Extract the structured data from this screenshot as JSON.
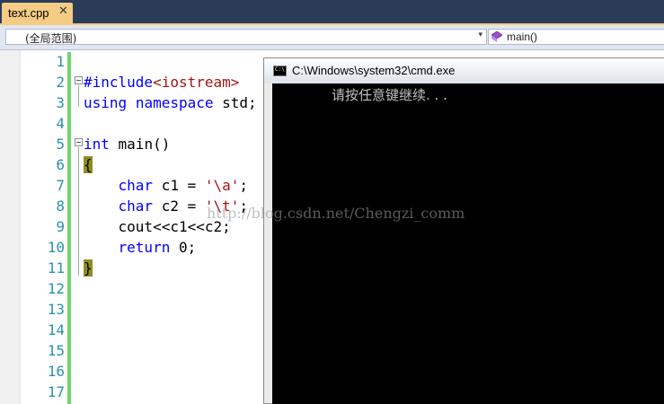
{
  "tab": {
    "filename": "text.cpp",
    "close_glyph": "✕"
  },
  "navbar": {
    "scope": "(全局范围)",
    "member": "main()",
    "dropdown_glyph": "▾"
  },
  "editor": {
    "line_numbers": [
      "1",
      "2",
      "3",
      "4",
      "5",
      "6",
      "7",
      "8",
      "9",
      "10",
      "11",
      "12",
      "13",
      "14",
      "15",
      "16",
      "17"
    ],
    "lines": {
      "l2_pp": "#include",
      "l2_inc": "<iostream>",
      "l3_kw1": "using",
      "l3_kw2": "namespace",
      "l3_rest": " std;",
      "l5_kw": "int",
      "l5_rest": " main()",
      "l6_brace": "{",
      "l7_kw": "char",
      "l7_mid": " c1 = ",
      "l7_str": "'\\a'",
      "l7_end": ";",
      "l8_kw": "char",
      "l8_mid": " c2 = ",
      "l8_str": "'\\t'",
      "l8_end": ";",
      "l9_text": "cout<<c1<<c2;",
      "l10_kw": "return",
      "l10_rest": " 0;",
      "l11_brace": "}"
    }
  },
  "cmd_window": {
    "title": "C:\\Windows\\system32\\cmd.exe",
    "icon_text": "C:\\",
    "output": "请按任意键继续. . ."
  },
  "watermark": "http://blog.csdn.net/Chengzi_comm",
  "colors": {
    "keyword": "#0000ff",
    "string": "#a31515",
    "line_number": "#2b91af",
    "tab_active": "#f5cc84",
    "change_bar": "#6ed66e"
  }
}
